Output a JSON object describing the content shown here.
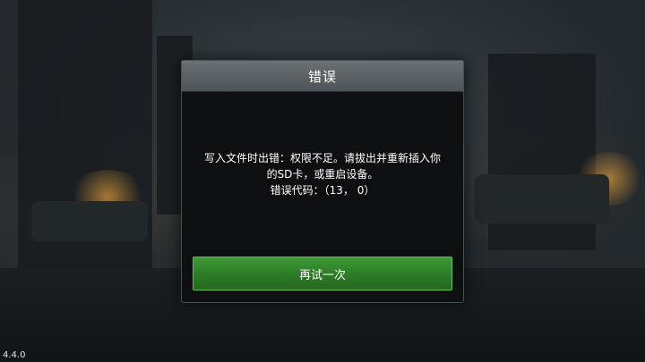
{
  "background": {
    "scene": "war-ruins-backdrop"
  },
  "dialog": {
    "title": "错误",
    "message_line1": "写入文件时出错：权限不足。请拔出并重新插入你",
    "message_line2": "的SD卡，或重启设备。",
    "message_line3": "错误代码：（13， 0）",
    "retry_label": "再试一次"
  },
  "footer": {
    "version": "4.4.0"
  },
  "colors": {
    "button_green": "#2c7a26",
    "header_gray": "#5d6367",
    "dialog_bg": "#0e0f10"
  }
}
